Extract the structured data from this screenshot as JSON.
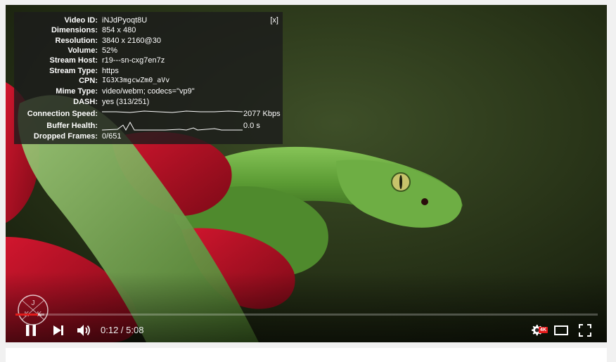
{
  "stats": {
    "close_label": "[x]",
    "rows": [
      {
        "label": "Video ID:",
        "value": "iNJdPyoqt8U"
      },
      {
        "label": "Dimensions:",
        "value": "854 x 480"
      },
      {
        "label": "Resolution:",
        "value": "3840 x 2160@30"
      },
      {
        "label": "Volume:",
        "value": "52%"
      },
      {
        "label": "Stream Host:",
        "value": "r19---sn-cxg7en7z"
      },
      {
        "label": "Stream Type:",
        "value": "https"
      },
      {
        "label": "CPN:",
        "value": "IG3X3mgcwZm0_aVv"
      },
      {
        "label": "Mime Type:",
        "value": "video/webm; codecs=\"vp9\""
      },
      {
        "label": "DASH:",
        "value": "yes (313/251)"
      }
    ],
    "connection_speed": {
      "label": "Connection Speed:",
      "value": "2077 Kbps"
    },
    "buffer_health": {
      "label": "Buffer Health:",
      "value": "0.0 s"
    },
    "dropped_frames": {
      "label": "Dropped Frames:",
      "value": "0/651"
    }
  },
  "controls": {
    "time": "0:12 / 5:08",
    "progress_played": 0.039,
    "progress_loaded": 0.05,
    "quality_badge": "4K",
    "accent_color": "#e21b1b"
  },
  "logo": {
    "letters": [
      "J",
      "K",
      "K"
    ]
  },
  "icons": {
    "pause": "pause-icon",
    "next": "next-icon",
    "volume": "volume-icon",
    "settings": "gear-icon",
    "theater": "theater-mode-icon",
    "fullscreen": "fullscreen-icon"
  }
}
